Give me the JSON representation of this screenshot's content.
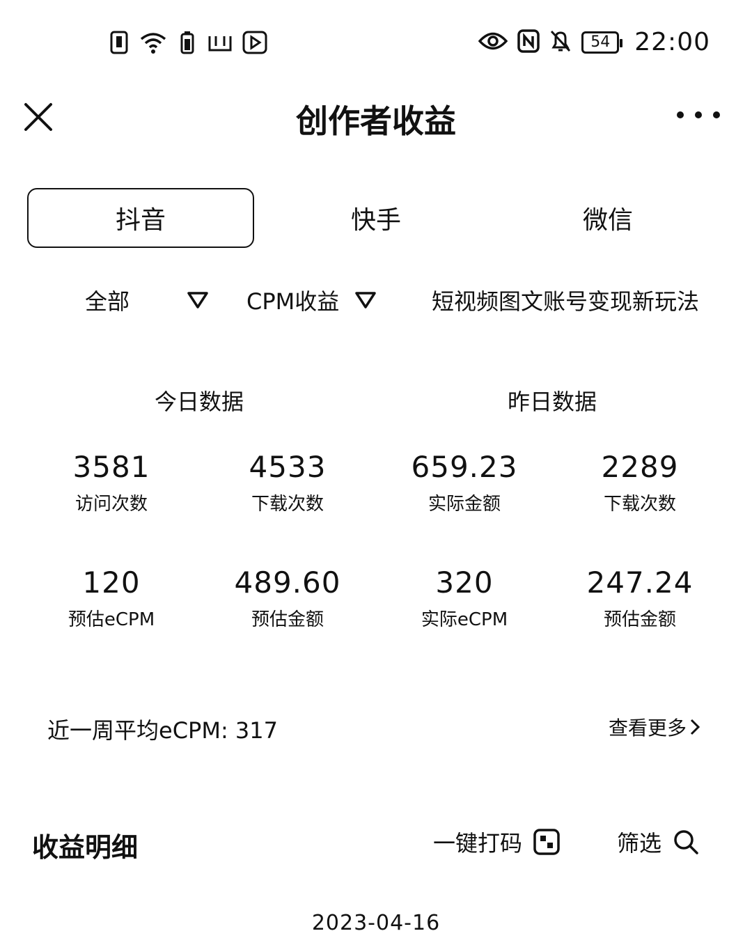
{
  "status_bar": {
    "left_icons": [
      "sim-card-icon",
      "wifi-icon",
      "battery-saver-icon",
      "app-notification-icon",
      "video-app-icon"
    ],
    "right_icons": [
      "eye-comfort-icon",
      "nfc-icon",
      "silent-bell-icon"
    ],
    "battery_level": "54",
    "time": "22:00"
  },
  "header": {
    "title": "创作者收益",
    "close_icon": "close-icon",
    "more_icon": "more-icon"
  },
  "platform_tabs": [
    {
      "label": "抖音",
      "active": true
    },
    {
      "label": "快手",
      "active": false
    },
    {
      "label": "微信",
      "active": false
    }
  ],
  "filters": {
    "scope": "全部",
    "metric": "CPM收益",
    "promo_text": "短视频图文账号变现新玩法"
  },
  "today": {
    "title": "今日数据",
    "stats": [
      {
        "value": "3581",
        "label": "访问次数"
      },
      {
        "value": "4533",
        "label": "下载次数"
      },
      {
        "value": "120",
        "label": "预估eCPM"
      },
      {
        "value": "489.60",
        "label": "预估金额"
      }
    ]
  },
  "yesterday": {
    "title": "昨日数据",
    "stats": [
      {
        "value": "659.23",
        "label": "实际金额"
      },
      {
        "value": "2289",
        "label": "下载次数"
      },
      {
        "value": "320",
        "label": "实际eCPM"
      },
      {
        "value": "247.24",
        "label": "预估金额"
      }
    ]
  },
  "weekly": {
    "avg_text": "近一周平均eCPM: 317",
    "more_label": "查看更多"
  },
  "details": {
    "title": "收益明细",
    "code_label": "一键打码",
    "filter_label": "筛选"
  },
  "list": {
    "date": "2023-04-16"
  }
}
